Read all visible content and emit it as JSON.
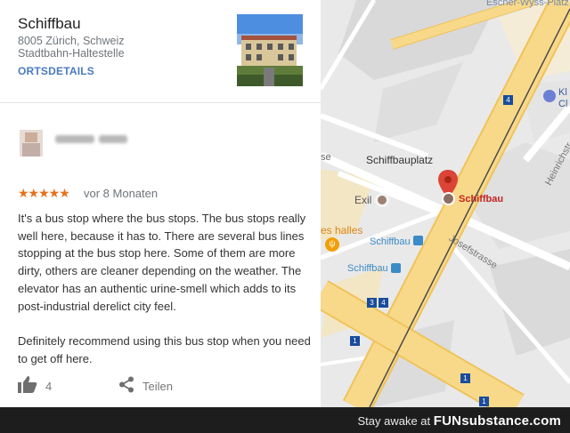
{
  "place": {
    "name": "Schiffbau",
    "address": "8005 Zürich, Schweiz",
    "category": "Stadtbahn-Haltestelle",
    "details_link": "ORTSDETAILS"
  },
  "review": {
    "stars": "★★★★★",
    "rating": 5,
    "time": "vor 8 Monaten",
    "text": "It's a bus stop where the bus stops. The bus stops really well here, because it has to. There are several bus lines stopping at the bus stop here. Some of them are more dirty, others are cleaner depending on the weather. The elevator has an authentic urine-smell which adds to its post-industrial derelict city feel.\n\nDefinitely recommend using this bus stop when you need to get off here.",
    "likes": "4",
    "share_label": "Teilen"
  },
  "map": {
    "labels": {
      "top_street": "Escher-Wyss-Platz",
      "square": "Schiffbauplatz",
      "place": "Schiffbau",
      "exil": "Exil",
      "halles": "es halles",
      "stop1": "Schiffbau",
      "stop2": "Schiffbau",
      "josef": "Josefstrasse",
      "heinrich": "Heinrichstr",
      "right_k": "Kl",
      "right_c": "Cl",
      "se": "se"
    },
    "route_badges": [
      "4",
      "4",
      "3",
      "4",
      "1",
      "1",
      "1"
    ],
    "colors": {
      "road": "#f8d98a",
      "road_edge": "#f0c35b",
      "block": "#e8e2d6",
      "pin": "#db4437",
      "transit": "#3b8cc6"
    }
  },
  "footer": {
    "prefix": "Stay awake at",
    "brand": "FUNsubstance.com"
  }
}
